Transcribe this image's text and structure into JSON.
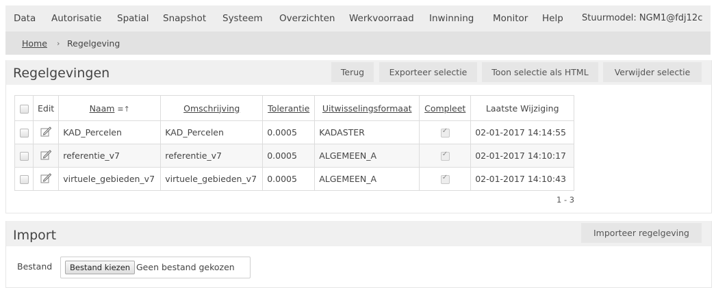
{
  "menu": {
    "items": [
      "Data",
      "Autorisatie",
      "Spatial",
      "Snapshot",
      "Systeem",
      "Overzichten",
      "Werkvoorraad",
      "Inwinning",
      "Monitor",
      "Help"
    ],
    "stuurmodel": "Stuurmodel: NGM1@fdj12c"
  },
  "breadcrumb": {
    "home": "Home",
    "separator": "›",
    "current": "Regelgeving"
  },
  "regelgevingen": {
    "title": "Regelgevingen",
    "buttons": {
      "terug": "Terug",
      "exporteer": "Exporteer selectie",
      "toon": "Toon selectie als HTML",
      "verwijder": "Verwijder selectie"
    },
    "columns": {
      "edit": "Edit",
      "naam": "Naam",
      "omschrijving": "Omschrijving",
      "tolerantie": "Tolerantie",
      "uitwisselingsformaat": "Uitwisselingsformaat",
      "compleet": "Compleet",
      "laatste_wijziging": "Laatste Wijziging"
    },
    "rows": [
      {
        "naam": "KAD_Percelen",
        "omschrijving": "KAD_Percelen",
        "tolerantie": "0.0005",
        "formaat": "KADASTER",
        "compleet": true,
        "wijziging": "02-01-2017 14:14:55"
      },
      {
        "naam": "referentie_v7",
        "omschrijving": "referentie_v7",
        "tolerantie": "0.0005",
        "formaat": "ALGEMEEN_A",
        "compleet": true,
        "wijziging": "02-01-2017 14:10:17"
      },
      {
        "naam": "virtuele_gebieden_v7",
        "omschrijving": "virtuele_gebieden_v7",
        "tolerantie": "0.0005",
        "formaat": "ALGEMEEN_A",
        "compleet": true,
        "wijziging": "02-01-2017 14:10:43"
      }
    ],
    "pager": "1 - 3"
  },
  "import": {
    "title": "Import",
    "button": "Importeer regelgeving",
    "bestand_label": "Bestand",
    "file_button": "Bestand kiezen",
    "file_status": "Geen bestand gekozen"
  }
}
